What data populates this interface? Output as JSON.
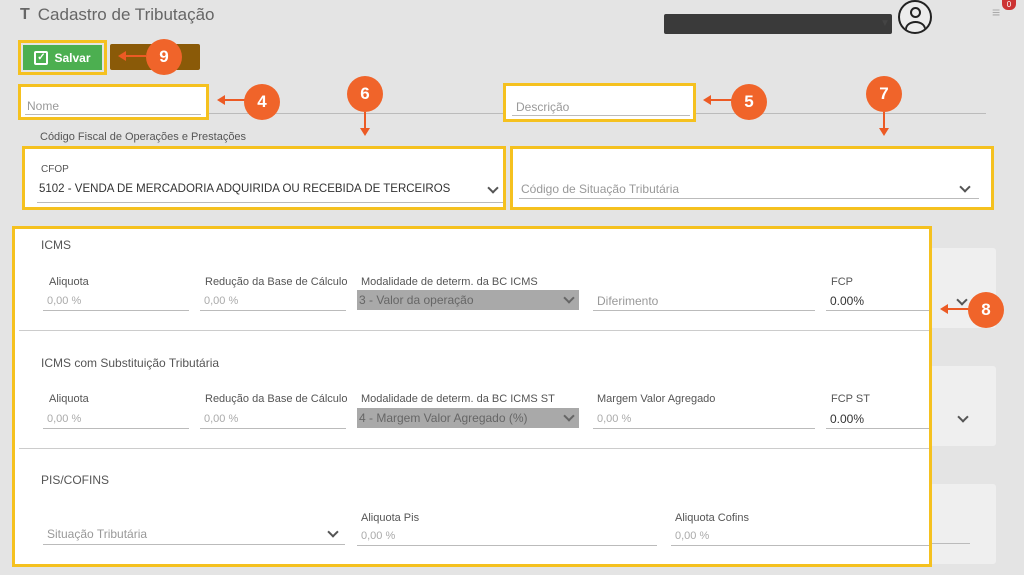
{
  "header": {
    "title": "Cadastro de Tributação",
    "title_icon": "T",
    "notif_count": "0"
  },
  "toolbar": {
    "save_label": "Salvar"
  },
  "form": {
    "nome_placeholder": "Nome",
    "descricao_placeholder": "Descrição",
    "cfop_section_label": "Código Fiscal de Operações e Prestações",
    "cfop_label": "CFOP",
    "cfop_value": "5102 - VENDA DE MERCADORIA ADQUIRIDA OU RECEBIDA DE TERCEIROS",
    "cst_placeholder": "Código de Situação Tributária"
  },
  "icms": {
    "title": "ICMS",
    "aliquota_label": "Aliquota",
    "aliquota_value": "0,00 %",
    "reducao_label": "Redução da Base de Cálculo",
    "reducao_value": "0,00 %",
    "modalidade_label": "Modalidade de determ. da BC ICMS",
    "modalidade_value": "3 - Valor da operação",
    "diferimento_placeholder": "Diferimento",
    "fcp_label": "FCP",
    "fcp_value": "0.00%"
  },
  "icms_st": {
    "title": "ICMS com Substituição Tributária",
    "aliquota_label": "Aliquota",
    "aliquota_value": "0,00 %",
    "reducao_label": "Redução da Base de Cálculo",
    "reducao_value": "0,00 %",
    "modalidade_label": "Modalidade de determ. da BC ICMS ST",
    "modalidade_value": "4 - Margem Valor Agregado (%)",
    "margem_label": "Margem Valor Agregado",
    "margem_value": "0,00 %",
    "fcp_st_label": "FCP ST",
    "fcp_st_value": "0.00%"
  },
  "pis_cofins": {
    "title": "PIS/COFINS",
    "situacao_placeholder": "Situação Tributária",
    "aliquota_pis_label": "Aliquota Pis",
    "aliquota_pis_value": "0,00 %",
    "aliquota_cofins_label": "Aliquota Cofins",
    "aliquota_cofins_value": "0,00 %"
  },
  "annotations": [
    "4",
    "5",
    "6",
    "7",
    "8",
    "9"
  ],
  "colors": {
    "highlight": "#f5c11f",
    "badge": "#f0642a",
    "save": "#4caf50"
  }
}
